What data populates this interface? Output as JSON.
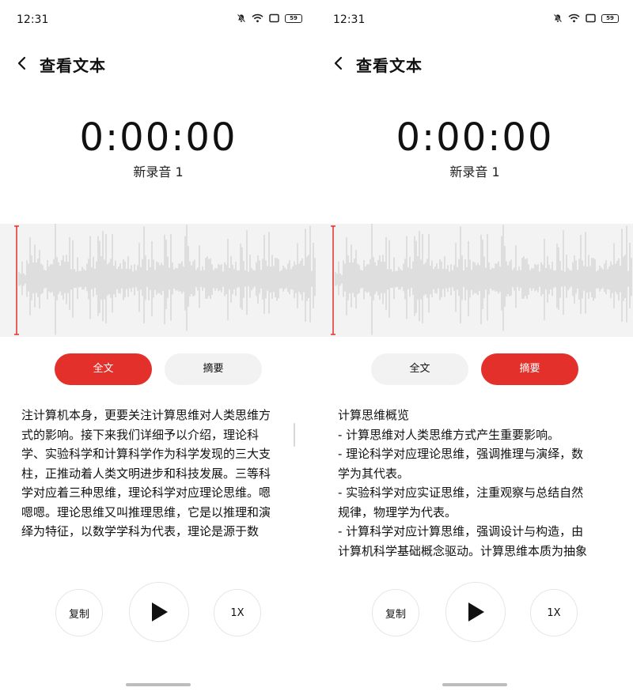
{
  "status_bar": {
    "time": "12:31",
    "battery": "59",
    "icons": [
      "mute-bell-icon",
      "wifi-icon",
      "screen-icon",
      "battery-icon"
    ]
  },
  "header": {
    "title": "查看文本",
    "back_icon": "chevron-left-icon"
  },
  "recording": {
    "timer": "0:00:00",
    "name": "新录音 1"
  },
  "tabs": {
    "full_text": "全文",
    "summary": "摘要"
  },
  "colors": {
    "accent": "#e3302a",
    "wave": "#d9d9d9",
    "wave_bg": "#f3f3f3",
    "pill_inactive": "#f2f2f2"
  },
  "left_screen": {
    "active_tab": "full_text",
    "lines": [
      "注计算机本身，更要关注计算思维对人类思维方",
      "式的影响。接下来我们详细予以介绍，理论科",
      "学、实验科学和计算科学作为科学发现的三大支",
      "柱，正推动着人类文明进步和科技发展。三等科",
      "学对应着三种思维，理论科学对应理论思维。嗯",
      "嗯嗯。理论思维又叫推理思维，它是以推理和演",
      "绎为特征，以数学学科为代表，理论是源于数"
    ]
  },
  "right_screen": {
    "active_tab": "summary",
    "lines": [
      "计算思维概览",
      "- 计算思维对人类思维方式产生重要影响。",
      "- 理论科学对应理论思维，强调推理与演绎，数",
      "学为其代表。",
      "- 实验科学对应实证思维，注重观察与总结自然",
      "规律，物理学为代表。",
      "- 计算科学对应计算思维，强调设计与构造，由",
      "计算机科学基础概念驱动。计算思维本质为抽象"
    ]
  },
  "controls": {
    "copy": "复制",
    "speed": "1X",
    "play_icon": "play-icon"
  }
}
